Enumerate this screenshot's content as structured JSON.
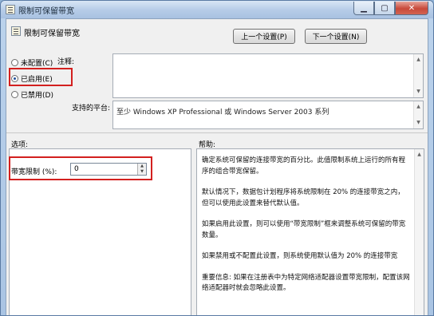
{
  "window": {
    "title": "限制可保留带宽"
  },
  "header": {
    "policy_title": "限制可保留带宽",
    "prev_button": "上一个设置(P)",
    "next_button": "下一个设置(N)"
  },
  "state": {
    "options": [
      {
        "label": "未配置(C)",
        "checked": false
      },
      {
        "label": "已启用(E)",
        "checked": true
      },
      {
        "label": "已禁用(D)",
        "checked": false
      }
    ]
  },
  "labels": {
    "comment": "注释:",
    "supported": "支持的平台:",
    "options": "选项:",
    "help": "帮助:"
  },
  "platform": {
    "value": "至少 Windows XP Professional 或 Windows Server 2003 系列"
  },
  "bandwidth": {
    "label": "带宽限制 (%):",
    "value": "0"
  },
  "help_paragraphs": [
    "确定系统可保留的连接带宽的百分比。此值限制系统上运行的所有程序的组合带宽保留。",
    "默认情况下，数据包计划程序将系统限制在 20% 的连接带宽之内，但可以使用此设置来替代默认值。",
    "如果启用此设置，则可以使用“带宽限制”框来调整系统可保留的带宽数量。",
    "如果禁用或不配置此设置，则系统使用默认值为 20% 的连接带宽",
    "重要信息: 如果在注册表中为特定网络适配器设置带宽限制，配置该网络适配器时就会忽略此设置。"
  ]
}
